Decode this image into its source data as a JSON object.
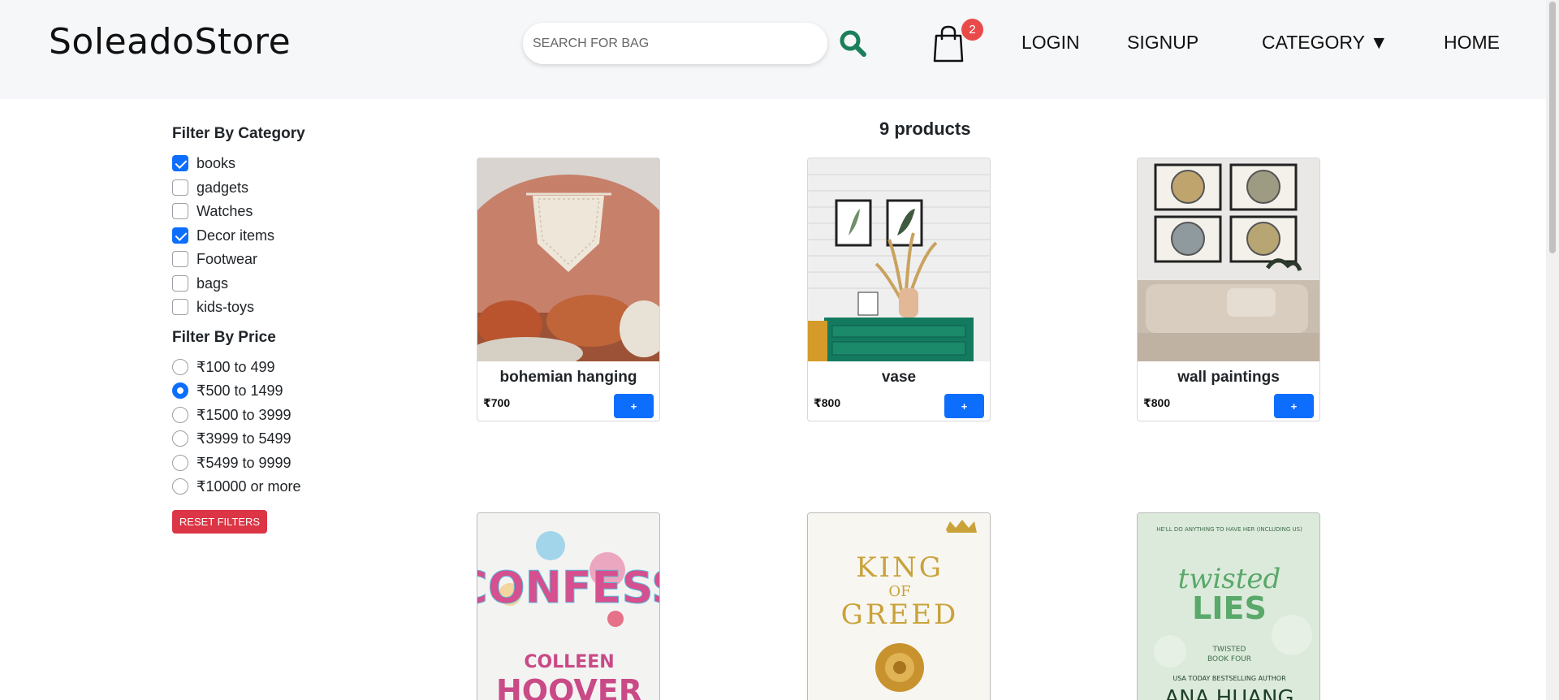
{
  "header": {
    "logo": "SoleadoStore",
    "search_placeholder": "SEARCH FOR BAG",
    "cart_count": "2",
    "nav": {
      "login": "LOGIN",
      "signup": "SIGNUP",
      "category": "CATEGORY ▼",
      "home": "HOME"
    },
    "colors": {
      "search_icon": "#1a7f5a",
      "badge": "#e94b4b"
    }
  },
  "sidebar": {
    "category_title": "Filter By Category",
    "categories": [
      {
        "label": "books",
        "checked": true
      },
      {
        "label": "gadgets",
        "checked": false
      },
      {
        "label": "Watches",
        "checked": false
      },
      {
        "label": "Decor items",
        "checked": true
      },
      {
        "label": "Footwear",
        "checked": false
      },
      {
        "label": "bags",
        "checked": false
      },
      {
        "label": "kids-toys",
        "checked": false
      }
    ],
    "price_title": "Filter By Price",
    "prices": [
      {
        "label": "₹100 to 499",
        "checked": false
      },
      {
        "label": "₹500 to 1499",
        "checked": true
      },
      {
        "label": "₹1500 to 3999",
        "checked": false
      },
      {
        "label": "₹3999 to 5499",
        "checked": false
      },
      {
        "label": "₹5499 to 9999",
        "checked": false
      },
      {
        "label": "₹10000 or more",
        "checked": false
      }
    ],
    "reset_label": "RESET FILTERS"
  },
  "main": {
    "products_count": "9 products",
    "products": [
      {
        "name": "bohemian hanging",
        "price": "₹700",
        "add_label": "+"
      },
      {
        "name": "vase",
        "price": "₹800",
        "add_label": "+"
      },
      {
        "name": "wall paintings",
        "price": "₹800",
        "add_label": "+"
      }
    ],
    "books": [
      {
        "title": "CONFESS",
        "author_line1": "COLLEEN",
        "author_line2": "HOOVER"
      },
      {
        "title_line1": "KING",
        "title_line2": "OF",
        "title_line3": "GREED"
      },
      {
        "top_line": "HE'LL DO ANYTHING TO HAVE HER (INCLUDING US)",
        "title_line1": "twisted",
        "title_line2": "LIES",
        "series_line1": "TWISTED",
        "series_line2": "BOOK FOUR",
        "tagline": "USA TODAY BESTSELLING AUTHOR",
        "author": "ANA HUANG"
      }
    ]
  }
}
